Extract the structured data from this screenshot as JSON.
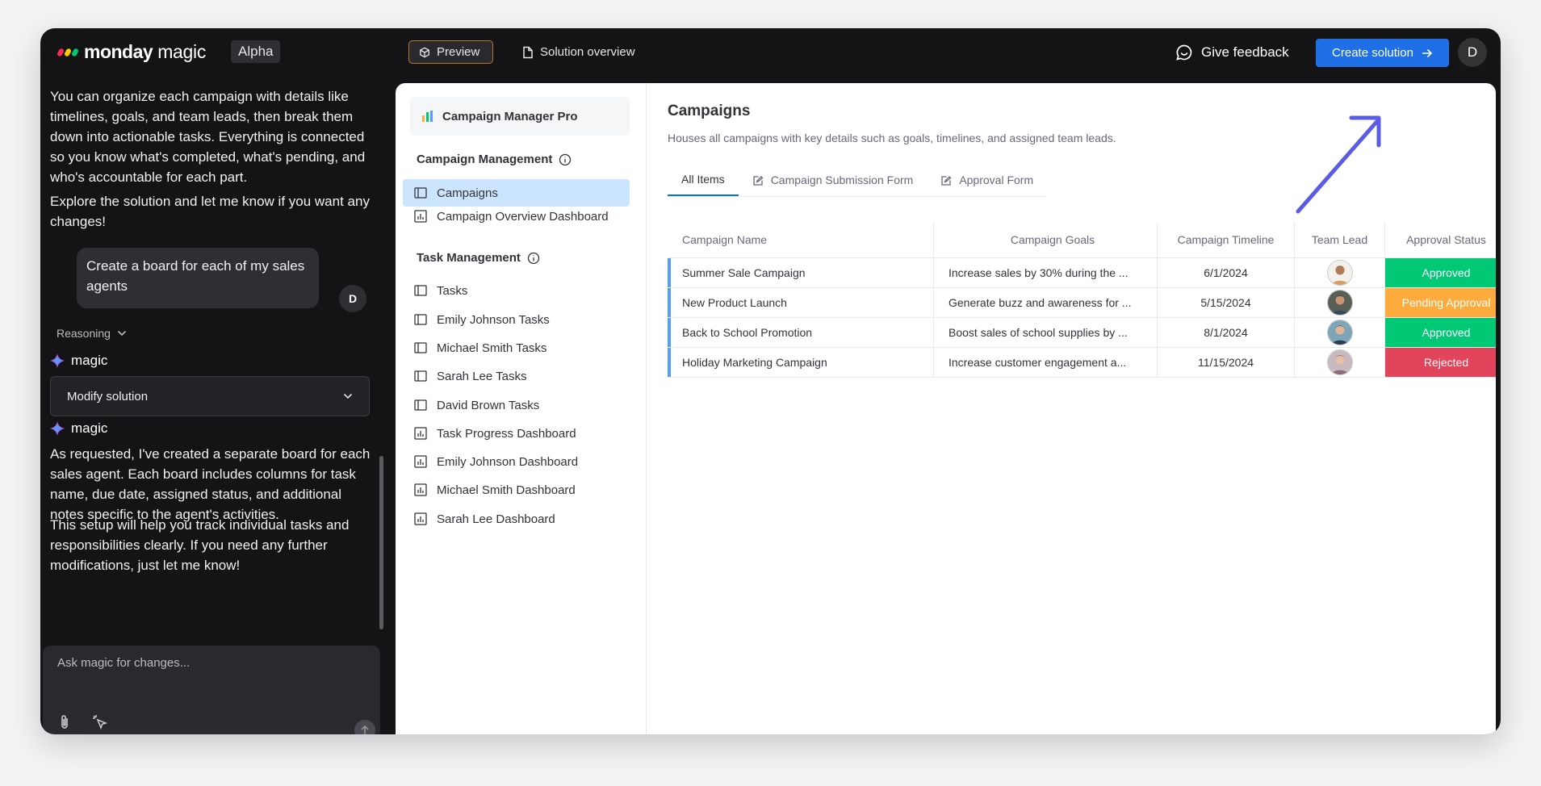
{
  "header": {
    "logo_brand": "monday",
    "logo_product": "magic",
    "badge": "Alpha",
    "tab_preview": "Preview",
    "tab_overview": "Solution overview",
    "feedback": "Give feedback",
    "create_button": "Create solution",
    "user_initial": "D"
  },
  "chat": {
    "intro": "You can organize each campaign with details like timelines, goals, and team leads, then break them down into actionable tasks. Everything is connected so you know what's completed, what's pending, and who's accountable for each part.",
    "explore": "Explore the solution and let me know if you want any changes!",
    "user_message": "Create a board for each of my sales agents",
    "user_initial": "D",
    "reasoning": "Reasoning",
    "assistant_name": "magic",
    "modify_dropdown": "Modify solution",
    "response_1": "As requested, I've created a separate board for each sales agent. Each board includes columns for task name, due date, assigned status, and additional notes specific to the agent's activities.",
    "response_2": "This setup will help you track individual tasks and responsibilities clearly. If you need any further modifications, just let me know!",
    "input_placeholder": "Ask magic for changes..."
  },
  "nav": {
    "workspace": "Campaign Manager Pro",
    "section_1": "Campaign Management",
    "section_1_items": [
      "Campaigns",
      "Campaign Overview Dashboard"
    ],
    "section_2": "Task Management",
    "section_2_items": [
      "Tasks",
      "Emily Johnson Tasks",
      "Michael Smith Tasks",
      "Sarah Lee Tasks",
      "David Brown Tasks",
      "Task Progress Dashboard",
      "Emily Johnson Dashboard",
      "Michael Smith Dashboard",
      "Sarah Lee Dashboard"
    ]
  },
  "board": {
    "title": "Campaigns",
    "description": "Houses all campaigns with key details such as goals, timelines, and assigned team leads.",
    "tabs": [
      "All Items",
      "Campaign Submission Form",
      "Approval Form"
    ],
    "columns": [
      "Campaign Name",
      "Campaign Goals",
      "Campaign Timeline",
      "Team Lead",
      "Approval Status"
    ],
    "rows": [
      {
        "name": "Summer Sale Campaign",
        "goals": "Increase sales by 30% during the ...",
        "timeline": "6/1/2024",
        "status": "Approved"
      },
      {
        "name": "New Product Launch",
        "goals": "Generate buzz and awareness for ...",
        "timeline": "5/15/2024",
        "status": "Pending Approval"
      },
      {
        "name": "Back to School Promotion",
        "goals": "Boost sales of school supplies by ...",
        "timeline": "8/1/2024",
        "status": "Approved"
      },
      {
        "name": "Holiday Marketing Campaign",
        "goals": "Increase customer engagement a...",
        "timeline": "11/15/2024",
        "status": "Rejected"
      }
    ]
  },
  "colors": {
    "approved": "#00c875",
    "pending": "#fdab3d",
    "rejected": "#e2445c",
    "accent": "#1f6fe6",
    "arrow": "#5b5ce6"
  },
  "icons": [
    "board-icon",
    "dashboard-icon",
    "info-icon",
    "form-icon",
    "feedback-icon",
    "arrow-right-icon",
    "chevron-down-icon",
    "sparkle-icon",
    "paperclip-icon",
    "cursor-icon",
    "send-icon",
    "cube-icon",
    "document-icon"
  ]
}
